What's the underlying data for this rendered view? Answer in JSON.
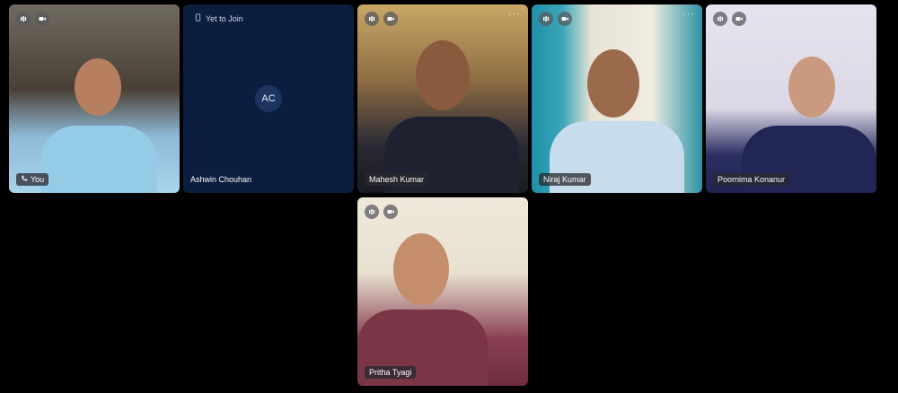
{
  "participants": [
    {
      "name": "You"
    },
    {
      "name": "Ashwin Chouhan",
      "initials": "AC",
      "status": "Yet to Join"
    },
    {
      "name": "Mahesh Kumar"
    },
    {
      "name": "Niraj Kumar"
    },
    {
      "name": "Poornima Konanur"
    },
    {
      "name": "Pritha Tyagi"
    }
  ],
  "more_label": "···",
  "icons": {
    "audio": "audio-level-icon",
    "video": "video-camera-icon",
    "mic_off": "mic-off-icon",
    "screen": "screen-share-icon",
    "phone": "phone-icon"
  }
}
